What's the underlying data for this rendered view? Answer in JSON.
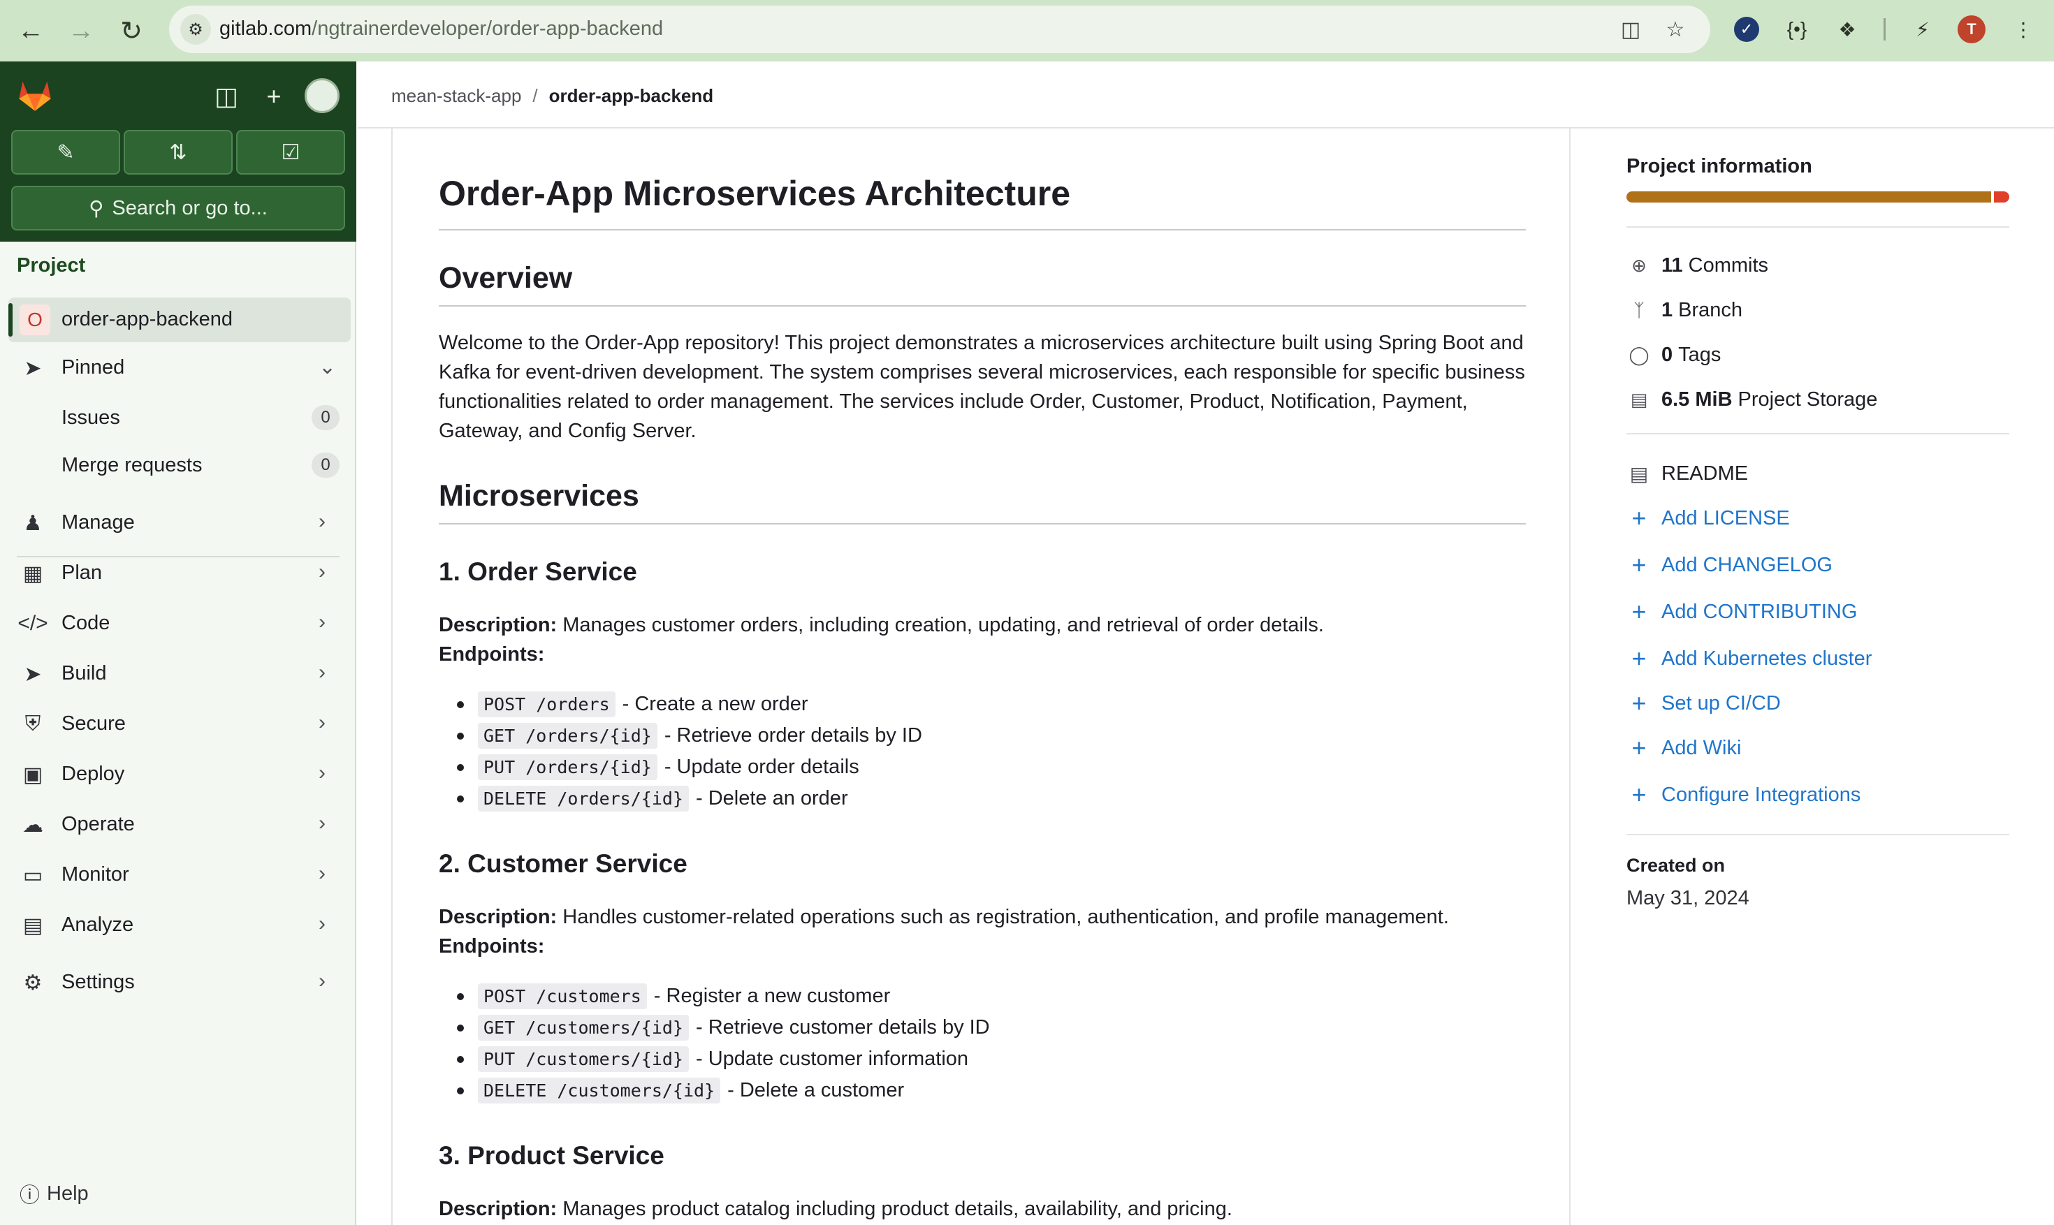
{
  "browser": {
    "url_host": "gitlab.com",
    "url_path": "/ngtrainerdeveloper/order-app-backend",
    "profile_initial": "T"
  },
  "sidebar": {
    "search_label": "Search or go to...",
    "section_label": "Project",
    "project": {
      "avatar_letter": "O",
      "name": "order-app-backend"
    },
    "pinned": {
      "label": "Pinned",
      "items": [
        {
          "label": "Issues",
          "count": "0"
        },
        {
          "label": "Merge requests",
          "count": "0"
        }
      ]
    },
    "nav": [
      {
        "label": "Manage"
      },
      {
        "label": "Plan"
      },
      {
        "label": "Code"
      },
      {
        "label": "Build"
      },
      {
        "label": "Secure"
      },
      {
        "label": "Deploy"
      },
      {
        "label": "Operate"
      },
      {
        "label": "Monitor"
      },
      {
        "label": "Analyze"
      },
      {
        "label": "Settings"
      }
    ],
    "help_label": "Help"
  },
  "breadcrumb": {
    "group": "mean-stack-app",
    "separator": "/",
    "current": "order-app-backend"
  },
  "readme": {
    "title": "Order-App Microservices Architecture",
    "overview_heading": "Overview",
    "overview_text": "Welcome to the Order-App repository! This project demonstrates a microservices architecture built using Spring Boot and Kafka for event-driven development. The system comprises several microservices, each responsible for specific business functionalities related to order management. The services include Order, Customer, Product, Notification, Payment, Gateway, and Config Server.",
    "microservices_heading": "Microservices",
    "description_label": "Description:",
    "endpoints_label": "Endpoints:",
    "services": [
      {
        "heading": "1. Order Service",
        "description": "Manages customer orders, including creation, updating, and retrieval of order details.",
        "endpoints": [
          {
            "code": "POST /orders",
            "text": "- Create a new order"
          },
          {
            "code": "GET /orders/{id}",
            "text": "- Retrieve order details by ID"
          },
          {
            "code": "PUT /orders/{id}",
            "text": "- Update order details"
          },
          {
            "code": "DELETE /orders/{id}",
            "text": "- Delete an order"
          }
        ]
      },
      {
        "heading": "2. Customer Service",
        "description": "Handles customer-related operations such as registration, authentication, and profile management.",
        "endpoints": [
          {
            "code": "POST /customers",
            "text": "- Register a new customer"
          },
          {
            "code": "GET /customers/{id}",
            "text": "- Retrieve customer details by ID"
          },
          {
            "code": "PUT /customers/{id}",
            "text": "- Update customer information"
          },
          {
            "code": "DELETE /customers/{id}",
            "text": "- Delete a customer"
          }
        ]
      },
      {
        "heading": "3. Product Service",
        "description": "Manages product catalog including product details, availability, and pricing."
      }
    ]
  },
  "project_info": {
    "heading": "Project information",
    "language_colors": [
      "#b07219",
      "#e0402a"
    ],
    "stats": [
      {
        "icon": "commit-icon",
        "value": "11",
        "label": "Commits"
      },
      {
        "icon": "branch-icon",
        "value": "1",
        "label": "Branch"
      },
      {
        "icon": "tag-icon",
        "value": "0",
        "label": "Tags"
      },
      {
        "icon": "storage-icon",
        "value": "6.5 MiB",
        "label": "Project Storage"
      }
    ],
    "readme_label": "README",
    "actions": [
      "Add LICENSE",
      "Add CHANGELOG",
      "Add CONTRIBUTING",
      "Add Kubernetes cluster",
      "Set up CI/CD",
      "Add Wiki",
      "Configure Integrations"
    ],
    "created_label": "Created on",
    "created_date": "May 31, 2024"
  }
}
